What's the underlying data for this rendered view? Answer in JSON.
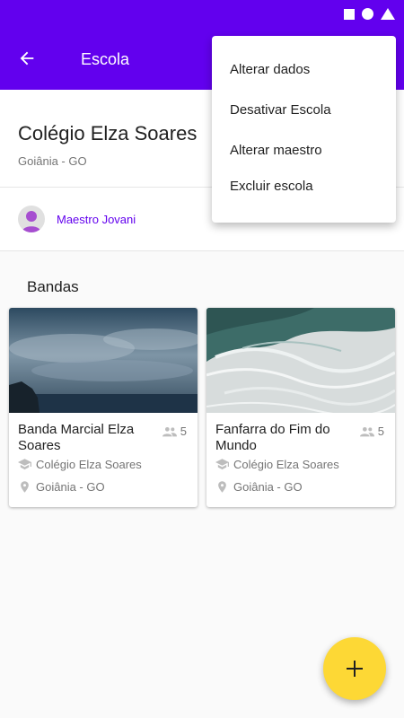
{
  "appbar": {
    "title": "Escola",
    "back_icon": "arrow-back-icon"
  },
  "school": {
    "name": "Colégio Elza Soares",
    "location": "Goiânia - GO"
  },
  "maestro": {
    "name": "Maestro Jovani"
  },
  "section": {
    "title": "Bandas"
  },
  "bands": [
    {
      "name": "Banda Marcial Elza Soares",
      "members": "5",
      "school": "Colégio Elza Soares",
      "city": "Goiânia - GO"
    },
    {
      "name": "Fanfarra do Fim do Mundo",
      "members": "5",
      "school": "Colégio Elza Soares",
      "city": "Goiânia - GO"
    }
  ],
  "menu": {
    "items": [
      "Alterar dados",
      "Desativar Escola",
      "Alterar maestro",
      "Excluir escola"
    ]
  },
  "fab": {
    "icon": "plus-icon"
  },
  "colors": {
    "primary": "#6200ee",
    "fab": "#fdd835",
    "secondary_text": "#757575"
  }
}
